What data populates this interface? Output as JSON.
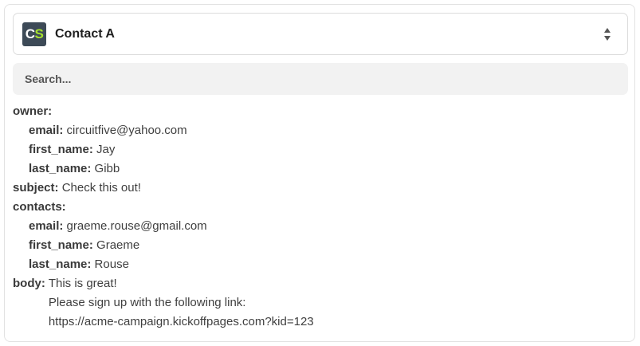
{
  "selector": {
    "logo_text_1": "C",
    "logo_text_2": "S",
    "label": "Contact A"
  },
  "search": {
    "placeholder": "Search..."
  },
  "fields": {
    "owner": {
      "key": "owner:",
      "email_key": "email:",
      "email": "circuitfive@yahoo.com",
      "first_name_key": "first_name:",
      "first_name": "Jay",
      "last_name_key": "last_name:",
      "last_name": "Gibb"
    },
    "subject": {
      "key": "subject:",
      "value": "Check this out!"
    },
    "contacts": {
      "key": "contacts:",
      "email_key": "email:",
      "email": "graeme.rouse@gmail.com",
      "first_name_key": "first_name:",
      "first_name": "Graeme",
      "last_name_key": "last_name:",
      "last_name": "Rouse"
    },
    "body": {
      "key": "body:",
      "lines": [
        "This is great!",
        "Please sign up with the following link:",
        "https://acme-campaign.kickoffpages.com?kid=123"
      ]
    }
  },
  "colors": {
    "logo_bg": "#3d4a57",
    "logo_accent": "#a6e22e",
    "search_bg": "#f2f2f2"
  },
  "icons": {
    "selector_toggle": "sort-arrows-icon"
  }
}
